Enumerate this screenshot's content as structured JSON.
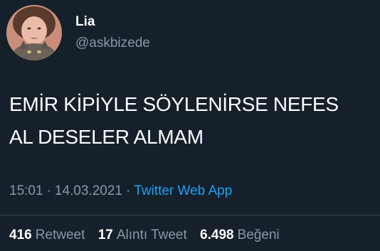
{
  "user": {
    "display_name": "Lia",
    "handle": "@askbizede",
    "avatar_icon": "profile-avatar-icon"
  },
  "tweet": {
    "text_line1": "EMİR KİPİYLE SÖYLENİRSE NEFES",
    "text_line2": "AL DESELER ALMAM"
  },
  "meta": {
    "time": "15:01",
    "date": "14.03.2021",
    "separator": "·",
    "source": "Twitter Web App"
  },
  "stats": {
    "retweets_count": "416",
    "retweets_label": "Retweet",
    "quotes_count": "17",
    "quotes_label": "Alıntı Tweet",
    "likes_count": "6.498",
    "likes_label": "Beğeni"
  },
  "colors": {
    "background": "#15202b",
    "text": "#ffffff",
    "secondary_text": "#8899a6",
    "link": "#1da1f2",
    "divider": "#38444d"
  }
}
